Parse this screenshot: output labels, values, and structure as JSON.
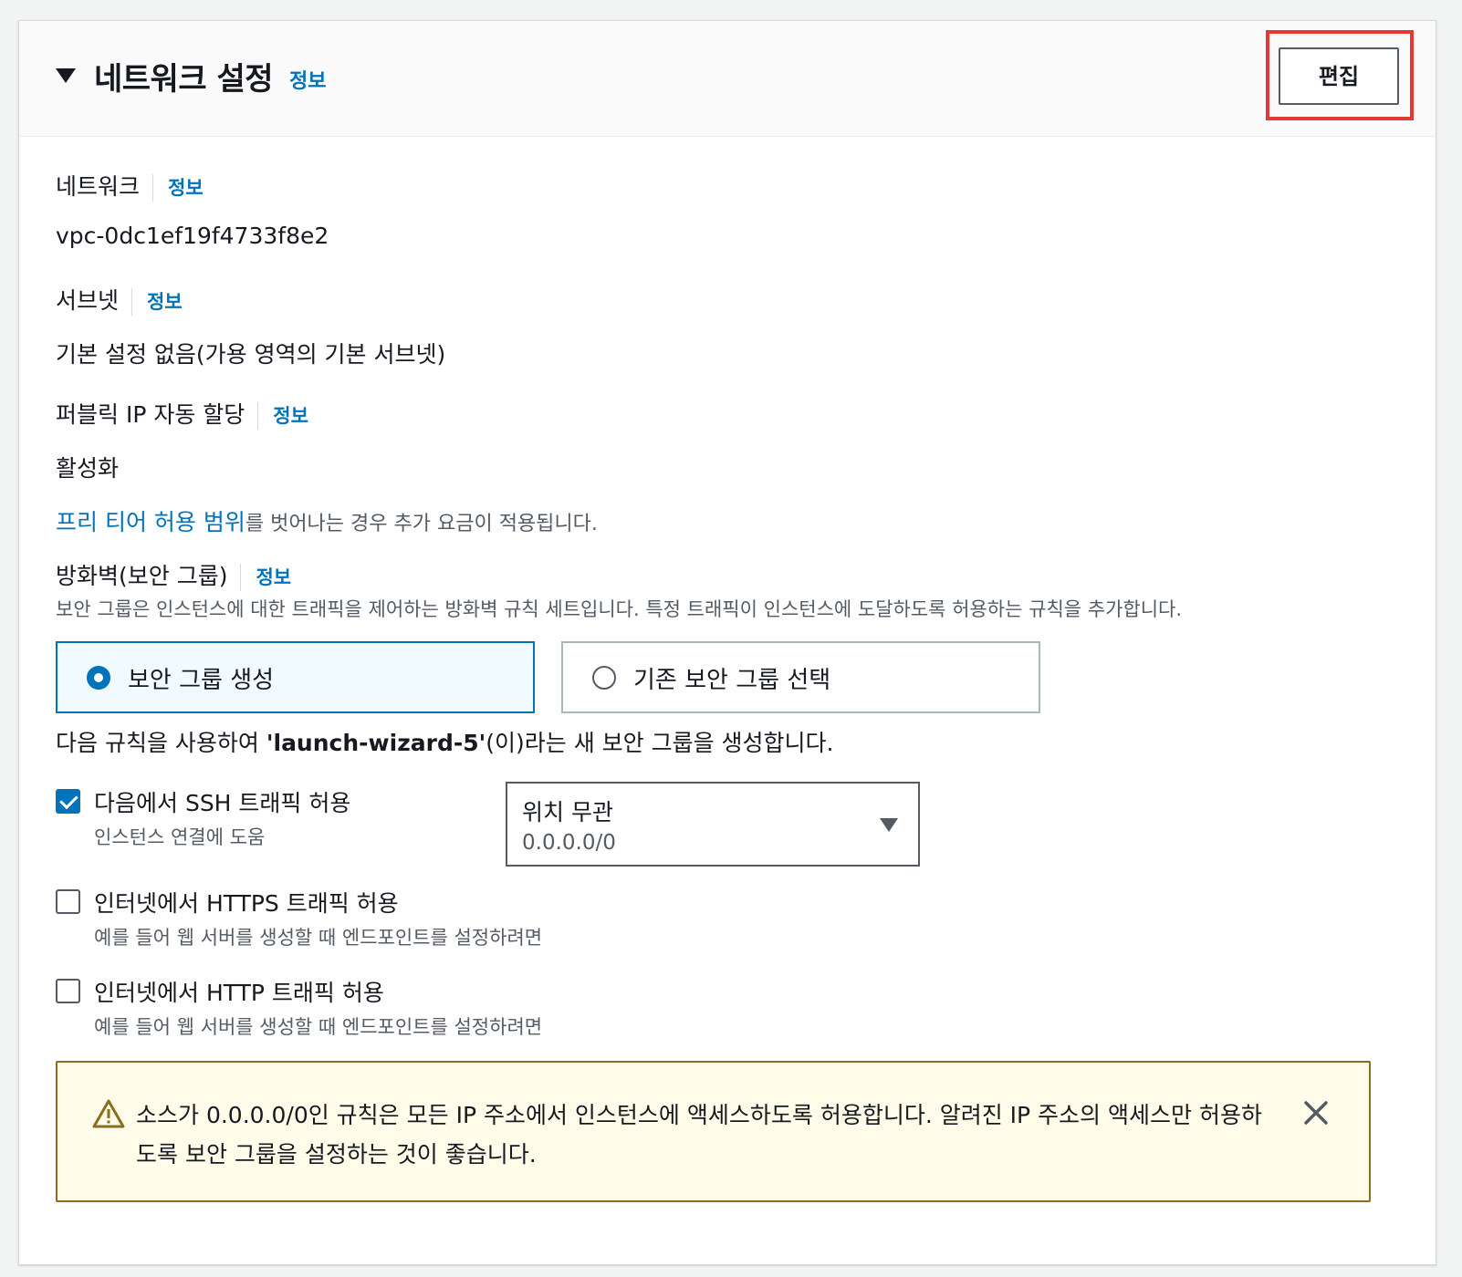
{
  "header": {
    "title": "네트워크 설정",
    "info": "정보",
    "edit_button": "편집"
  },
  "network": {
    "label": "네트워크",
    "info": "정보",
    "value": "vpc-0dc1ef19f4733f8e2"
  },
  "subnet": {
    "label": "서브넷",
    "info": "정보",
    "value": "기본 설정 없음(가용 영역의 기본 서브넷)"
  },
  "public_ip": {
    "label": "퍼블릭 IP 자동 할당",
    "info": "정보",
    "value": "활성화",
    "note_link": "프리 티어 허용 범위",
    "note_text": "를 벗어나는 경우 추가 요금이 적용됩니다."
  },
  "firewall": {
    "label": "방화벽(보안 그룹)",
    "info": "정보",
    "description": "보안 그룹은 인스턴스에 대한 트래픽을 제어하는 방화벽 규칙 세트입니다. 특정 트래픽이 인스턴스에 도달하도록 허용하는 규칙을 추가합니다.",
    "options": [
      {
        "label": "보안 그룹 생성",
        "selected": true
      },
      {
        "label": "기존 보안 그룹 선택",
        "selected": false
      }
    ],
    "rule_prefix": "다음 규칙을 사용하여 ",
    "rule_name": "'launch-wizard-5'",
    "rule_suffix": "(이)라는 새 보안 그룹을 생성합니다."
  },
  "rules": [
    {
      "label": "다음에서 SSH 트래픽 허용",
      "description": "인스턴스 연결에 도움",
      "checked": true
    },
    {
      "label": "인터넷에서 HTTPS 트래픽 허용",
      "description": "예를 들어 웹 서버를 생성할 때 엔드포인트를 설정하려면",
      "checked": false
    },
    {
      "label": "인터넷에서 HTTP 트래픽 허용",
      "description": "예를 들어 웹 서버를 생성할 때 엔드포인트를 설정하려면",
      "checked": false
    }
  ],
  "ssh_source": {
    "selected": "위치 무관",
    "cidr": "0.0.0.0/0"
  },
  "warning": {
    "text": "소스가 0.0.0.0/0인 규칙은 모든 IP 주소에서 인스턴스에 액세스하도록 허용합니다. 알려진 IP 주소의 액세스만 허용하도록 보안 그룹을 설정하는 것이 좋습니다."
  },
  "colors": {
    "link": "#0073bb",
    "highlight": "#e53935",
    "warning_border": "#8c6d1f",
    "warning_bg": "#fffce9"
  }
}
